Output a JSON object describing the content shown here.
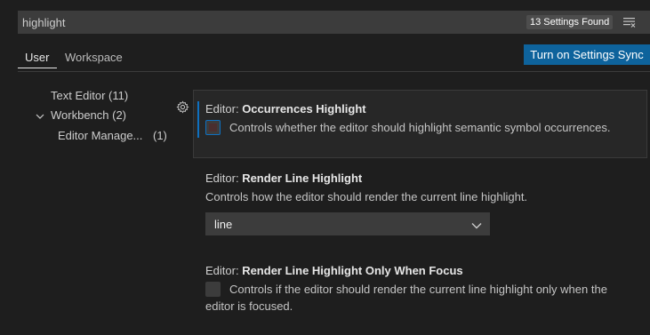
{
  "search": {
    "value": "highlight",
    "result_count": "13 Settings Found"
  },
  "tabs": [
    {
      "label": "User"
    },
    {
      "label": "Workspace"
    }
  ],
  "sync_button": {
    "label": "Turn on Settings Sync"
  },
  "toc": [
    {
      "label": "Text Editor (11)"
    },
    {
      "label": "Workbench (2)"
    },
    {
      "label": "Editor Manage...",
      "count": "(1)"
    }
  ],
  "settings": [
    {
      "category": "Editor: ",
      "name": "Occurrences Highlight",
      "description": "Controls whether the editor should highlight semantic symbol occurrences."
    },
    {
      "category": "Editor: ",
      "name": "Render Line Highlight",
      "description": "Controls how the editor should render the current line highlight.",
      "selected_value": "line"
    },
    {
      "category": "Editor: ",
      "name": "Render Line Highlight Only When Focus",
      "description_line1": "Controls if the editor should render the current line highlight only when the",
      "description_line2": "editor is focused."
    }
  ],
  "colors": {
    "accent": "#0e639c",
    "focus": "#0e70c0",
    "background": "#1e1e1e"
  },
  "icons": [
    "clear-filter-icon",
    "chevron-down-icon",
    "gear-icon",
    "select-chevron-icon"
  ]
}
